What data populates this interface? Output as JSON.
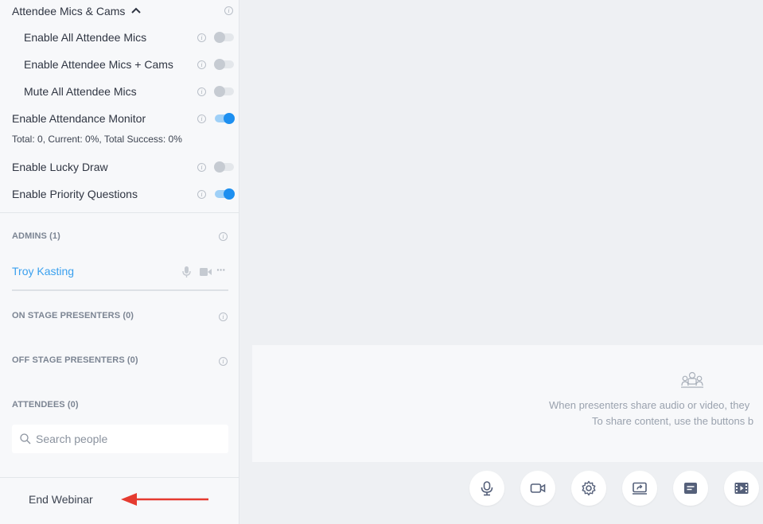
{
  "settings": {
    "mics_cams_header": "Attendee Mics & Cams",
    "enable_all_mics": "Enable All Attendee Mics",
    "enable_mics_cams": "Enable Attendee Mics + Cams",
    "mute_all_mics": "Mute All Attendee Mics",
    "attendance_monitor": "Enable Attendance Monitor",
    "attendance_stats": "Total: 0, Current: 0%, Total Success: 0%",
    "lucky_draw": "Enable Lucky Draw",
    "priority_questions": "Enable Priority Questions",
    "info_glyph": "i"
  },
  "toggles": {
    "enable_all_mics": "off",
    "enable_mics_cams": "off",
    "mute_all_mics": "off",
    "attendance_monitor": "on",
    "lucky_draw": "off",
    "priority_questions": "on"
  },
  "admins": {
    "title": "ADMINS (1)",
    "name": "Troy Kasting",
    "more": "···"
  },
  "on_stage": {
    "title": "ON STAGE PRESENTERS (0)"
  },
  "off_stage": {
    "title": "OFF STAGE PRESENTERS (0)"
  },
  "attendees": {
    "title": "ATTENDEES (0)",
    "search_placeholder": "Search people"
  },
  "footer": {
    "end_label": "End Webinar"
  },
  "stage": {
    "line1": "When presenters share audio or video, they",
    "line2": "To share content, use the buttons b"
  },
  "controls": [
    "microphone-icon",
    "camera-icon",
    "settings-icon",
    "share-screen-icon",
    "chat-icon",
    "media-icon"
  ],
  "colors": {
    "accent": "#1d8ff0",
    "admin_name": "#3aa0ee",
    "annotation_arrow": "#e53b30"
  }
}
